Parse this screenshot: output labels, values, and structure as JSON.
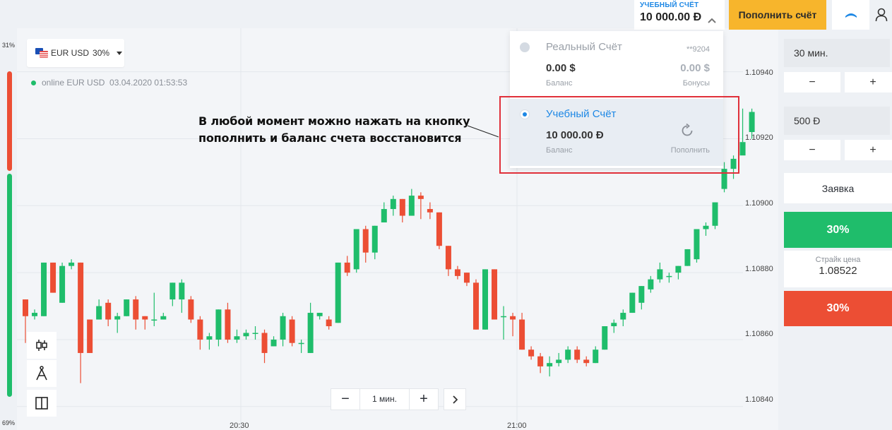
{
  "header": {
    "account_type": "УЧЕБНЫЙ СЧЁТ",
    "account_balance": "10 000.00 Đ",
    "deposit_label": "Пополнить счёт"
  },
  "side_bar": {
    "top_percent": "31%",
    "bottom_percent": "69%"
  },
  "pair_selector": {
    "pair": "EUR USD",
    "payout": "30%"
  },
  "status_line": {
    "text": "online EUR USD  03.04.2020 01:53:53"
  },
  "zoom": {
    "minus": "−",
    "interval": "1 мин.",
    "plus": "+",
    "next": "›"
  },
  "accounts": {
    "real": {
      "name": "Реальный Счёт",
      "number": "**9204",
      "balance": "0.00 $",
      "balance_label": "Баланс",
      "bonus": "0.00 $",
      "bonus_label": "Бонусы"
    },
    "demo": {
      "name": "Учебный Счёт",
      "balance": "10 000.00 Đ",
      "balance_label": "Баланс",
      "refill_label": "Пополнить"
    }
  },
  "annotation": {
    "line1": "В любой момент можно нажать на кнопку",
    "line2": "пополнить и баланс счета восстановится"
  },
  "trade_panel": {
    "duration": "30 мин.",
    "amount": "500 Đ",
    "minus": "−",
    "plus": "+",
    "order_label": "Заявка",
    "call_payout": "30%",
    "strike_label": "Страйк цена",
    "strike_value": "1.08522",
    "put_payout": "30%"
  },
  "colors": {
    "up": "#1fbd6b",
    "down": "#ec4e34",
    "accent": "#1e88e5",
    "deposit": "#f7b52c",
    "highlight": "#e0303a"
  },
  "chart_data": {
    "type": "candlestick",
    "y_ticks": [
      "1.10940",
      "1.10920",
      "1.10900",
      "1.10880",
      "1.10860",
      "1.10840"
    ],
    "x_ticks": [
      "20:30",
      "21:00"
    ],
    "ylim": [
      1.10833,
      1.10953
    ],
    "candles": [
      {
        "o": 1.10872,
        "c": 1.10867,
        "h": 1.10872,
        "l": 1.10859
      },
      {
        "o": 1.10867,
        "c": 1.10868,
        "h": 1.10869,
        "l": 1.10866
      },
      {
        "o": 1.10867,
        "c": 1.10883,
        "h": 1.10883,
        "l": 1.10867
      },
      {
        "o": 1.10883,
        "c": 1.10874,
        "h": 1.10883,
        "l": 1.10874
      },
      {
        "o": 1.10871,
        "c": 1.10882,
        "h": 1.10883,
        "l": 1.10871
      },
      {
        "o": 1.10882,
        "c": 1.10883,
        "h": 1.10884,
        "l": 1.10881
      },
      {
        "o": 1.10883,
        "c": 1.10856,
        "h": 1.10883,
        "l": 1.10847
      },
      {
        "o": 1.10866,
        "c": 1.10856,
        "h": 1.10866,
        "l": 1.10856
      },
      {
        "o": 1.10866,
        "c": 1.1087,
        "h": 1.10872,
        "l": 1.10866
      },
      {
        "o": 1.10871,
        "c": 1.10866,
        "h": 1.10872,
        "l": 1.10864
      },
      {
        "o": 1.10866,
        "c": 1.10867,
        "h": 1.10868,
        "l": 1.10862
      },
      {
        "o": 1.10867,
        "c": 1.10872,
        "h": 1.10872,
        "l": 1.10867
      },
      {
        "o": 1.10872,
        "c": 1.10866,
        "h": 1.10873,
        "l": 1.10863
      },
      {
        "o": 1.10867,
        "c": 1.10866,
        "h": 1.10867,
        "l": 1.10863
      },
      {
        "o": 1.10866,
        "c": 1.10866,
        "h": 1.10874,
        "l": 1.10864
      },
      {
        "o": 1.10866,
        "c": 1.10867,
        "h": 1.10868,
        "l": 1.10866
      },
      {
        "o": 1.10872,
        "c": 1.10877,
        "h": 1.10877,
        "l": 1.1087
      },
      {
        "o": 1.10872,
        "c": 1.10877,
        "h": 1.10878,
        "l": 1.10868
      },
      {
        "o": 1.10872,
        "c": 1.10866,
        "h": 1.10873,
        "l": 1.10865
      },
      {
        "o": 1.10866,
        "c": 1.1086,
        "h": 1.10867,
        "l": 1.10857
      },
      {
        "o": 1.1086,
        "c": 1.10861,
        "h": 1.10862,
        "l": 1.10857
      },
      {
        "o": 1.1086,
        "c": 1.10869,
        "h": 1.10869,
        "l": 1.10858
      },
      {
        "o": 1.10869,
        "c": 1.1086,
        "h": 1.10871,
        "l": 1.10859
      },
      {
        "o": 1.1086,
        "c": 1.10861,
        "h": 1.10863,
        "l": 1.10859
      },
      {
        "o": 1.10861,
        "c": 1.10862,
        "h": 1.10863,
        "l": 1.1086
      },
      {
        "o": 1.10862,
        "c": 1.10862,
        "h": 1.10864,
        "l": 1.1086
      },
      {
        "o": 1.10862,
        "c": 1.10856,
        "h": 1.10863,
        "l": 1.10853
      },
      {
        "o": 1.10858,
        "c": 1.1086,
        "h": 1.10861,
        "l": 1.10858
      },
      {
        "o": 1.1086,
        "c": 1.10867,
        "h": 1.10868,
        "l": 1.10858
      },
      {
        "o": 1.10866,
        "c": 1.10859,
        "h": 1.10867,
        "l": 1.10858
      },
      {
        "o": 1.10859,
        "c": 1.10859,
        "h": 1.1086,
        "l": 1.10856
      },
      {
        "o": 1.10856,
        "c": 1.10868,
        "h": 1.10871,
        "l": 1.10856
      },
      {
        "o": 1.10867,
        "c": 1.10868,
        "h": 1.10868,
        "l": 1.10866
      },
      {
        "o": 1.10866,
        "c": 1.10864,
        "h": 1.10867,
        "l": 1.10863
      },
      {
        "o": 1.10865,
        "c": 1.10883,
        "h": 1.10883,
        "l": 1.10865
      },
      {
        "o": 1.10883,
        "c": 1.1088,
        "h": 1.10885,
        "l": 1.10879
      },
      {
        "o": 1.10881,
        "c": 1.10893,
        "h": 1.10893,
        "l": 1.1088
      },
      {
        "o": 1.10893,
        "c": 1.10886,
        "h": 1.10894,
        "l": 1.10883
      },
      {
        "o": 1.10886,
        "c": 1.10894,
        "h": 1.10894,
        "l": 1.10884
      },
      {
        "o": 1.10895,
        "c": 1.10899,
        "h": 1.10901,
        "l": 1.10895
      },
      {
        "o": 1.10899,
        "c": 1.10902,
        "h": 1.10903,
        "l": 1.10897
      },
      {
        "o": 1.10902,
        "c": 1.10897,
        "h": 1.10902,
        "l": 1.10895
      },
      {
        "o": 1.10897,
        "c": 1.10903,
        "h": 1.10905,
        "l": 1.10897
      },
      {
        "o": 1.10903,
        "c": 1.10902,
        "h": 1.10904,
        "l": 1.10896
      },
      {
        "o": 1.10899,
        "c": 1.10898,
        "h": 1.10901,
        "l": 1.10896
      },
      {
        "o": 1.10898,
        "c": 1.10888,
        "h": 1.10898,
        "l": 1.10887
      },
      {
        "o": 1.10888,
        "c": 1.10881,
        "h": 1.10888,
        "l": 1.10879
      },
      {
        "o": 1.10881,
        "c": 1.10879,
        "h": 1.10882,
        "l": 1.10878
      },
      {
        "o": 1.1088,
        "c": 1.10877,
        "h": 1.1088,
        "l": 1.10876
      },
      {
        "o": 1.10877,
        "c": 1.10863,
        "h": 1.10878,
        "l": 1.10863
      },
      {
        "o": 1.10863,
        "c": 1.10881,
        "h": 1.10881,
        "l": 1.10863
      },
      {
        "o": 1.10881,
        "c": 1.10866,
        "h": 1.10881,
        "l": 1.10866
      },
      {
        "o": 1.10867,
        "c": 1.10867,
        "h": 1.1087,
        "l": 1.1086
      },
      {
        "o": 1.10867,
        "c": 1.10866,
        "h": 1.10868,
        "l": 1.10861
      },
      {
        "o": 1.10866,
        "c": 1.10857,
        "h": 1.10868,
        "l": 1.10857
      },
      {
        "o": 1.10857,
        "c": 1.10855,
        "h": 1.10858,
        "l": 1.10854
      },
      {
        "o": 1.10855,
        "c": 1.10852,
        "h": 1.10856,
        "l": 1.1085
      },
      {
        "o": 1.10852,
        "c": 1.10853,
        "h": 1.10855,
        "l": 1.10849
      },
      {
        "o": 1.10853,
        "c": 1.10854,
        "h": 1.10856,
        "l": 1.10852
      },
      {
        "o": 1.10854,
        "c": 1.10857,
        "h": 1.10858,
        "l": 1.10853
      },
      {
        "o": 1.10857,
        "c": 1.10854,
        "h": 1.10858,
        "l": 1.10853
      },
      {
        "o": 1.10854,
        "c": 1.10853,
        "h": 1.10855,
        "l": 1.10852
      },
      {
        "o": 1.10853,
        "c": 1.10857,
        "h": 1.10858,
        "l": 1.10853
      },
      {
        "o": 1.10857,
        "c": 1.10864,
        "h": 1.10864,
        "l": 1.10857
      },
      {
        "o": 1.10864,
        "c": 1.10865,
        "h": 1.10866,
        "l": 1.10862
      },
      {
        "o": 1.10866,
        "c": 1.10868,
        "h": 1.10869,
        "l": 1.10864
      },
      {
        "o": 1.10868,
        "c": 1.10874,
        "h": 1.10874,
        "l": 1.10868
      },
      {
        "o": 1.10871,
        "c": 1.10876,
        "h": 1.10876,
        "l": 1.10869
      },
      {
        "o": 1.10875,
        "c": 1.10878,
        "h": 1.10879,
        "l": 1.10874
      },
      {
        "o": 1.10878,
        "c": 1.10881,
        "h": 1.10883,
        "l": 1.10877
      },
      {
        "o": 1.10879,
        "c": 1.10879,
        "h": 1.1088,
        "l": 1.10877
      },
      {
        "o": 1.1088,
        "c": 1.10882,
        "h": 1.10882,
        "l": 1.10878
      },
      {
        "o": 1.10882,
        "c": 1.10887,
        "h": 1.10887,
        "l": 1.10882
      },
      {
        "o": 1.10884,
        "c": 1.10893,
        "h": 1.10893,
        "l": 1.10883
      },
      {
        "o": 1.10893,
        "c": 1.10894,
        "h": 1.10895,
        "l": 1.10891
      },
      {
        "o": 1.10894,
        "c": 1.10901,
        "h": 1.10901,
        "l": 1.10893
      },
      {
        "o": 1.10905,
        "c": 1.10911,
        "h": 1.10913,
        "l": 1.10904
      },
      {
        "o": 1.10911,
        "c": 1.10914,
        "h": 1.10915,
        "l": 1.10908
      },
      {
        "o": 1.10915,
        "c": 1.10919,
        "h": 1.10929,
        "l": 1.10919
      },
      {
        "o": 1.10922,
        "c": 1.10928,
        "h": 1.10929,
        "l": 1.1092
      }
    ]
  }
}
